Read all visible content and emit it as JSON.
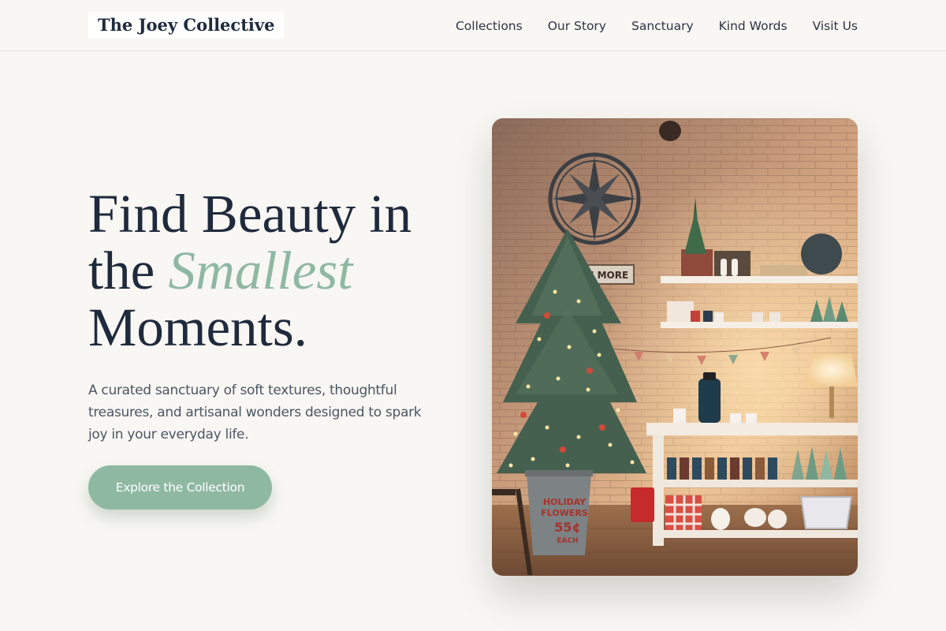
{
  "brand": {
    "name": "The Joey Collective"
  },
  "nav": {
    "links": [
      "Collections",
      "Our Story",
      "Sanctuary",
      "Kind Words",
      "Visit Us"
    ]
  },
  "hero": {
    "headline_line1": "Find Beauty in",
    "headline_the": "the",
    "headline_accent": "Smallest",
    "headline_line3": "Moments.",
    "tagline": "A curated sanctuary of soft textures, thoughtful treasures, and artisanal wonders designed to spark joy in your everyday life.",
    "cta_label": "Explore the Collection"
  },
  "photo": {
    "sign_text": "E YOU MORE",
    "bucket_text_1": "HOLIDAY",
    "bucket_text_2": "FLOWERS",
    "bucket_price": "55¢",
    "bucket_each": "EACH"
  },
  "colors": {
    "background": "#f8f7f3",
    "accent": "#8fb8a3",
    "heading": "#1f2a3d",
    "body_text": "#4b5563"
  },
  "icons": [
    "compass-wall-decor-icon"
  ]
}
